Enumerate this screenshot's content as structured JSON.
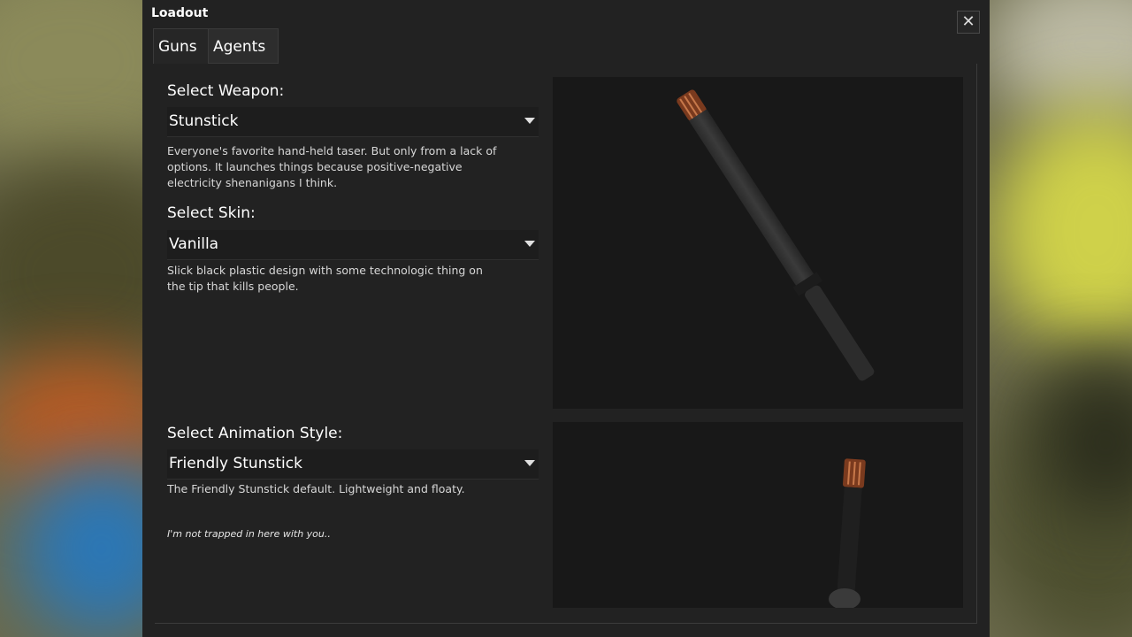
{
  "window": {
    "title": "Loadout",
    "close_symbol": "✕"
  },
  "tabs": [
    {
      "label": "Guns",
      "active": true
    },
    {
      "label": "Agents",
      "active": false
    }
  ],
  "weapon": {
    "label": "Select Weapon:",
    "value": "Stunstick",
    "description": "Everyone's favorite hand-held taser. But only from a lack of options. It launches things because positive-negative electricity shenanigans I think."
  },
  "skin": {
    "label": "Select Skin:",
    "value": "Vanilla",
    "description": "Slick black plastic design with some technologic thing on the tip that kills people."
  },
  "animation": {
    "label": "Select Animation Style:",
    "value": "Friendly Stunstick",
    "description": "The Friendly Stunstick default. Lightweight and floaty."
  },
  "flavor_text": "I'm not trapped in here with you..",
  "icons": {
    "close": "close-icon",
    "dropdown": "chevron-down-icon"
  }
}
